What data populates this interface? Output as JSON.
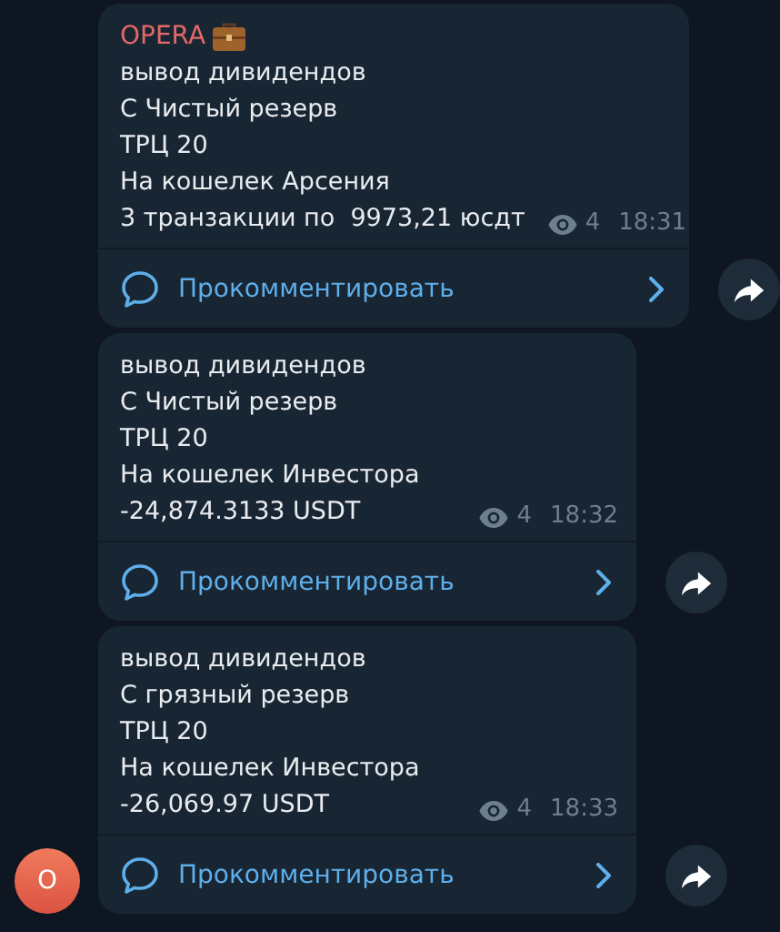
{
  "messages": [
    {
      "sender": "OPERA",
      "lines": [
        "вывод дивидендов",
        "С Чистый резерв",
        "ТРЦ 20",
        "На кошелек Арсения",
        "3 транзакции по  9973,21 юсдт"
      ],
      "views": "4",
      "time": "18:31",
      "comment_label": "Прокомментировать"
    },
    {
      "lines": [
        "вывод дивидендов",
        "С Чистый резерв",
        "ТРЦ 20",
        "На кошелек Инвестора",
        "-24,874.3133 USDT"
      ],
      "views": "4",
      "time": "18:32",
      "comment_label": "Прокомментировать"
    },
    {
      "lines": [
        "вывод дивидендов",
        "С грязный резерв",
        "ТРЦ 20",
        "На кошелек Инвестора",
        "-26,069.97 USDT"
      ],
      "views": "4",
      "time": "18:33",
      "comment_label": "Прокомментировать",
      "avatar": "O"
    }
  ]
}
